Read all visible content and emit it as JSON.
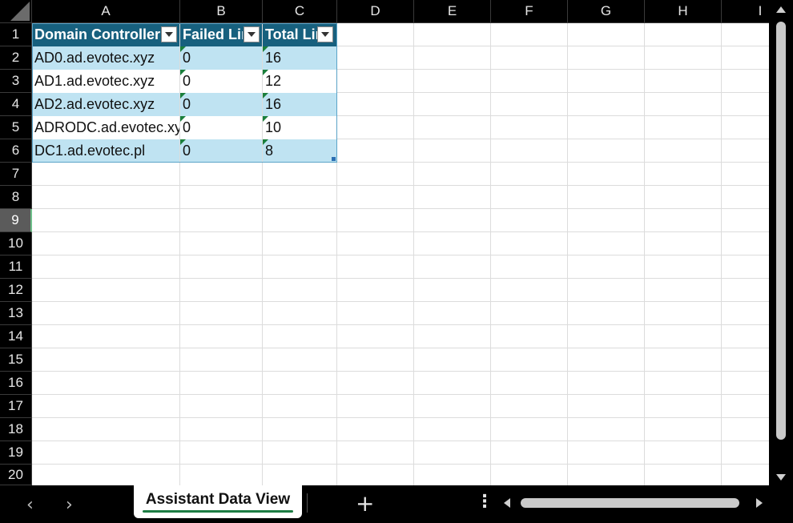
{
  "columns": [
    "A",
    "B",
    "C",
    "D",
    "E",
    "F",
    "G",
    "H",
    "I"
  ],
  "rows": [
    "1",
    "2",
    "3",
    "4",
    "5",
    "6",
    "7",
    "8",
    "9",
    "10",
    "11",
    "12",
    "13",
    "14",
    "15",
    "16",
    "17",
    "18",
    "19",
    "20"
  ],
  "selected_row": "9",
  "table": {
    "headers": [
      "Domain Controller",
      "Failed Links",
      "Total Links"
    ],
    "rows": [
      [
        "AD0.ad.evotec.xyz",
        "0",
        "16"
      ],
      [
        "AD1.ad.evotec.xyz",
        "0",
        "12"
      ],
      [
        "AD2.ad.evotec.xyz",
        "0",
        "16"
      ],
      [
        "ADRODC.ad.evotec.xyz",
        "0",
        "10"
      ],
      [
        "DC1.ad.evotec.pl",
        "0",
        "8"
      ]
    ]
  },
  "sheet_tab": {
    "label": "Assistant Data View"
  },
  "icons": {
    "prev_sheet": "chevron-left-icon",
    "next_sheet": "chevron-right-icon",
    "add_sheet": "plus-icon",
    "more": "vertical-dots-icon"
  },
  "colors": {
    "table_header": "#17607e",
    "band": "#bfe3f2",
    "tab_accent": "#1e7d44"
  }
}
